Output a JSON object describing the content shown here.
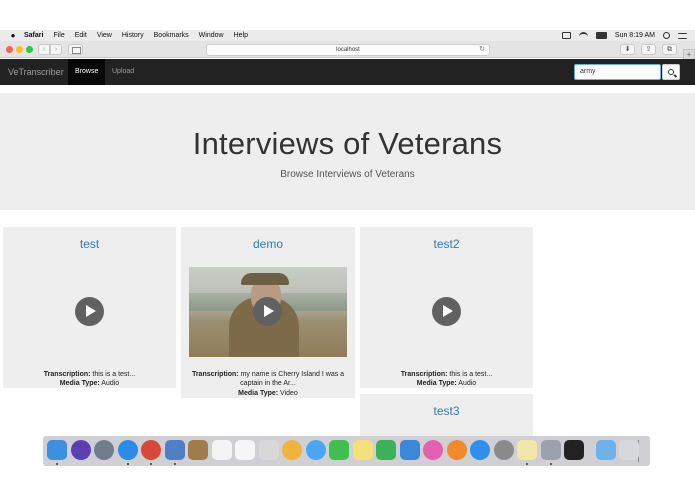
{
  "menubar": {
    "apple": "",
    "app_name": "Safari",
    "items": [
      "File",
      "Edit",
      "View",
      "History",
      "Bookmarks",
      "Window",
      "Help"
    ],
    "clock": "Sun 8:19 AM"
  },
  "browser": {
    "url": "localhost",
    "reload_glyph": "↻",
    "back_glyph": "‹",
    "forward_glyph": "›",
    "download_glyph": "⬇",
    "share_glyph": "⇪",
    "tabs_glyph": "⧉",
    "new_tab_glyph": "+"
  },
  "navbar": {
    "brand": "VeTranscriber",
    "links": [
      {
        "label": "Browse",
        "active": true
      },
      {
        "label": "Upload",
        "active": false
      }
    ],
    "search_value": "army"
  },
  "jumbotron": {
    "title": "Interviews of Veterans",
    "subtitle": "Browse Interviews of Veterans"
  },
  "cards": [
    {
      "title": "test",
      "transcription_label": "Transcription:",
      "transcription": "this is a test...",
      "media_label": "Media Type:",
      "media_type": "Audio"
    },
    {
      "title": "demo",
      "transcription_label": "Transcription:",
      "transcription_line1": "my name is Cherry Island I was a",
      "transcription_line2": "captain in the Ar...",
      "media_label": "Media Type:",
      "media_type": "Video"
    },
    {
      "title": "test2",
      "transcription_label": "Transcription:",
      "transcription": "this is a test...",
      "media_label": "Media Type:",
      "media_type": "Audio"
    },
    {
      "title": "test3"
    }
  ],
  "dock": {
    "apps": [
      {
        "name": "finder-icon",
        "color": "#3d8fe0"
      },
      {
        "name": "siri-icon",
        "color": "#5a3fb5"
      },
      {
        "name": "launchpad-icon",
        "color": "#6f7d8c"
      },
      {
        "name": "safari-icon",
        "color": "#2b8be6"
      },
      {
        "name": "chrome-icon",
        "color": "#d9473b"
      },
      {
        "name": "preview-icon",
        "color": "#4f7fc7"
      },
      {
        "name": "notes-brown-icon",
        "color": "#a07b4c"
      },
      {
        "name": "calendar-icon",
        "color": "#f4f4f4"
      },
      {
        "name": "reminders-icon",
        "color": "#f6f6f6"
      },
      {
        "name": "photos-preview-icon",
        "color": "#d8d8d8"
      },
      {
        "name": "photos-icon",
        "color": "#f2b33d"
      },
      {
        "name": "messages-icon",
        "color": "#4aa6f0"
      },
      {
        "name": "facetime-icon",
        "color": "#3fbf4f"
      },
      {
        "name": "notes-icon",
        "color": "#f5e07a"
      },
      {
        "name": "numbers-icon",
        "color": "#3bb25a"
      },
      {
        "name": "keynote-icon",
        "color": "#3b88d8"
      },
      {
        "name": "itunes-icon",
        "color": "#e55fb0"
      },
      {
        "name": "ibooks-icon",
        "color": "#f08a2a"
      },
      {
        "name": "app-store-icon",
        "color": "#2f8ef0"
      },
      {
        "name": "system-preferences-icon",
        "color": "#8a8a8a"
      },
      {
        "name": "stickies-icon",
        "color": "#f1e7a8"
      },
      {
        "name": "disk-utility-icon",
        "color": "#9aa3ad"
      },
      {
        "name": "terminal-icon",
        "color": "#222222"
      },
      {
        "name": "folder-icon",
        "color": "#6fb1e9"
      },
      {
        "name": "trash-icon",
        "color": "#d6d8db"
      }
    ]
  }
}
